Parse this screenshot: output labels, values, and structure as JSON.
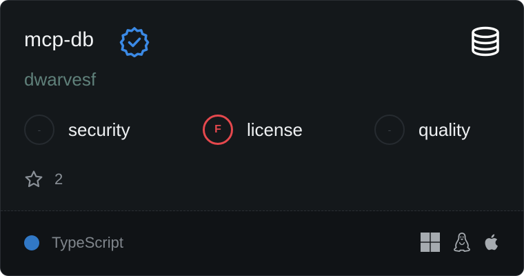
{
  "server": {
    "name": "mcp-db",
    "verified_icon": "verified-badge-icon",
    "category_icon": "database-icon",
    "owner": "dwarvesf"
  },
  "metrics": [
    {
      "grade": "-",
      "label": "security",
      "status": "empty"
    },
    {
      "grade": "F",
      "label": "license",
      "status": "fail"
    },
    {
      "grade": "-",
      "label": "quality",
      "status": "empty"
    }
  ],
  "stars": {
    "icon": "star-icon",
    "count": "2"
  },
  "footer": {
    "language": "TypeScript",
    "language_color": "#3178c6",
    "platforms": [
      "windows-icon",
      "linux-icon",
      "apple-icon"
    ]
  },
  "colors": {
    "card_bg": "#14181b",
    "footer_bg": "#101316",
    "verified": "#3b8ae6",
    "fail": "#e5484d",
    "owner": "#5f807a"
  }
}
